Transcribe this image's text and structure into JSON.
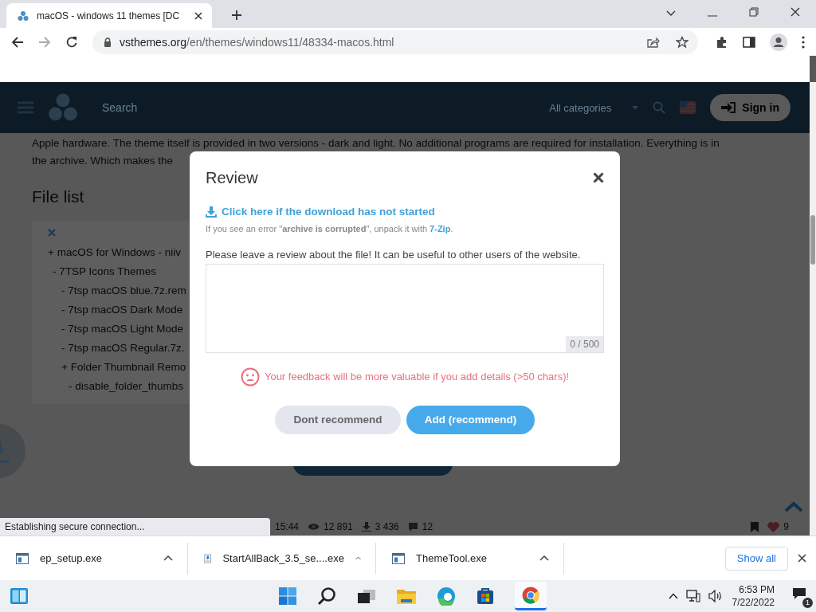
{
  "browser": {
    "tab": {
      "title": "macOS - windows 11 themes [DC",
      "selected": true
    },
    "url": {
      "host": "vsthemes.org",
      "path": "/en/themes/windows11/48334-macos.html"
    }
  },
  "site": {
    "header": {
      "search": {
        "placeholder": "Search"
      },
      "category": "All categories",
      "sign_in": "Sign in"
    },
    "description": [
      "Apple hardware. The theme itself is provided in two versions - dark and light. No additional programs are required for installation. Everything is in",
      "the archive. Which makes the"
    ],
    "file_list": {
      "title": "File list",
      "tree": [
        {
          "label": "+ macOS for Windows - niiv",
          "children": [
            {
              "label": "- 7TSP Icons Themes",
              "children": [
                {
                  "label": "- 7tsp macOS blue.7z.rem"
                },
                {
                  "label": "- 7tsp macOS Dark Mode"
                },
                {
                  "label": "- 7tsp macOS Light Mode"
                },
                {
                  "label": "- 7tsp macOS Regular.7z."
                },
                {
                  "label": "+ Folder Thumbnail Remo",
                  "children": [
                    {
                      "label": "- disable_folder_thumbs"
                    }
                  ]
                }
              ]
            }
          ]
        }
      ]
    },
    "stats": {
      "time": "15:44",
      "views": "12 891",
      "downloads": "3 436",
      "comments": "12",
      "likes": "9"
    },
    "status": "Establishing secure connection..."
  },
  "modal": {
    "title": "Review",
    "download_link": "Click here if the download has not started",
    "note": "If you see an error \"**archive is corrupted**\", unpack it with ",
    "note_link": "7-Zip",
    "note_end": ".",
    "prompt": "Please leave a review about the file! It can be useful to other users of the website.",
    "counter": "0 / 500",
    "warning": "Your feedback will be more valuable if you add details (>50 chars)!",
    "buttons": [
      {
        "label": "Dont recommend",
        "kind": "secondary"
      },
      {
        "label": "Add (recommend)",
        "kind": "primary"
      }
    ]
  },
  "downloads": {
    "items": [
      {
        "name": "ep_setup.exe",
        "kind": "app"
      },
      {
        "name": "StartAllBack_3.5_se....exe",
        "kind": "installer"
      },
      {
        "name": "ThemeTool.exe",
        "kind": "app"
      }
    ],
    "show_all": "Show all"
  },
  "taskbar": {
    "time": "6:53 PM",
    "date": "7/22/2022",
    "notifications": "1"
  }
}
